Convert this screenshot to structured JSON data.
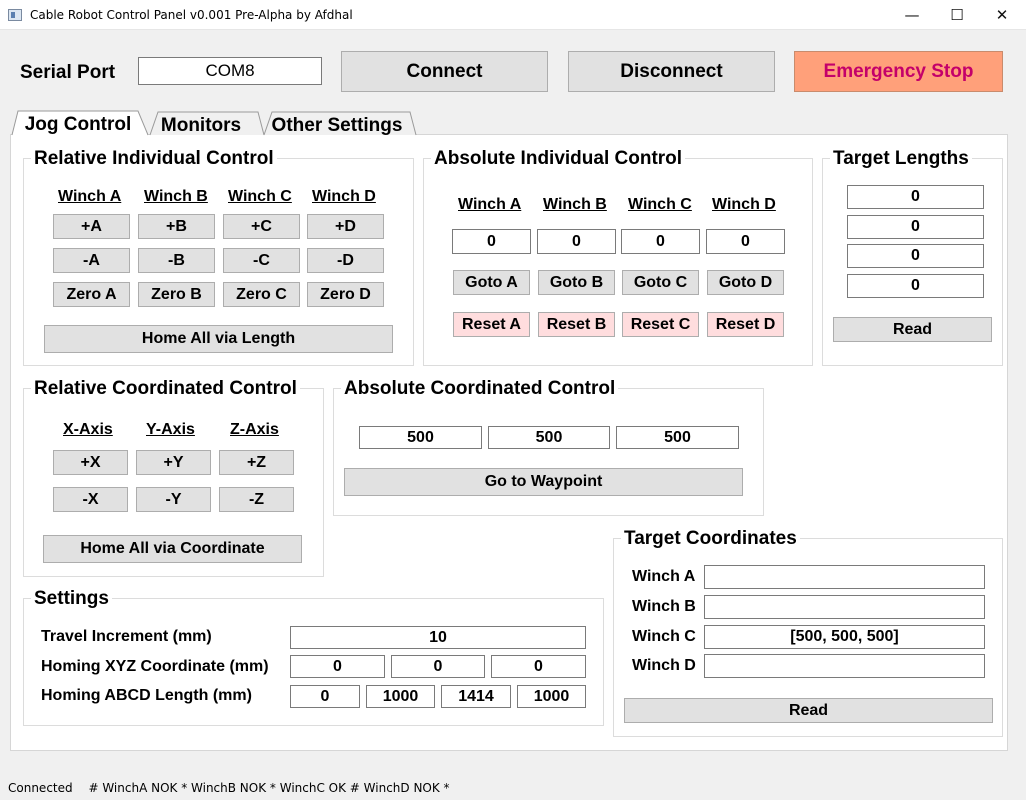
{
  "window": {
    "title": "Cable Robot Control Panel v0.001 Pre-Alpha by Afdhal",
    "controls": {
      "minimize": "—",
      "maximize": "☐",
      "close": "✕"
    }
  },
  "header": {
    "serial_port_label": "Serial Port",
    "serial_port_value": "COM8",
    "connect_label": "Connect",
    "disconnect_label": "Disconnect",
    "emergency_label": "Emergency Stop"
  },
  "tabs": [
    "Jog Control",
    "Monitors",
    "Other Settings"
  ],
  "relative_individual": {
    "title": "Relative Individual Control",
    "headers": [
      "Winch A",
      "Winch B",
      "Winch C",
      "Winch D"
    ],
    "plus": [
      "+A",
      "+B",
      "+C",
      "+D"
    ],
    "minus": [
      "-A",
      "-B",
      "-C",
      "-D"
    ],
    "zero": [
      "Zero A",
      "Zero B",
      "Zero C",
      "Zero D"
    ],
    "home_label": "Home All via Length"
  },
  "absolute_individual": {
    "title": "Absolute Individual Control",
    "headers": [
      "Winch A",
      "Winch B",
      "Winch C",
      "Winch D"
    ],
    "values": [
      "0",
      "0",
      "0",
      "0"
    ],
    "goto": [
      "Goto A",
      "Goto B",
      "Goto C",
      "Goto D"
    ],
    "reset": [
      "Reset A",
      "Reset B",
      "Reset C",
      "Reset D"
    ]
  },
  "target_lengths": {
    "title": "Target Lengths",
    "values": [
      "0",
      "0",
      "0",
      "0"
    ],
    "read_label": "Read"
  },
  "relative_coordinated": {
    "title": "Relative Coordinated Control",
    "headers": [
      "X-Axis",
      "Y-Axis",
      "Z-Axis"
    ],
    "plus": [
      "+X",
      "+Y",
      "+Z"
    ],
    "minus": [
      "-X",
      "-Y",
      "-Z"
    ],
    "home_label": "Home All via Coordinate"
  },
  "absolute_coordinated": {
    "title": "Absolute Coordinated Control",
    "values": [
      "500",
      "500",
      "500"
    ],
    "waypoint_label": "Go to Waypoint"
  },
  "target_coordinates": {
    "title": "Target Coordinates",
    "labels": [
      "Winch A",
      "Winch B",
      "Winch C",
      "Winch D"
    ],
    "values": [
      "",
      "",
      "[500, 500, 500]",
      ""
    ],
    "read_label": "Read"
  },
  "settings": {
    "title": "Settings",
    "travel_label": "Travel Increment (mm)",
    "travel_value": "10",
    "homing_xyz_label": "Homing XYZ Coordinate (mm)",
    "homing_xyz_values": [
      "0",
      "0",
      "0"
    ],
    "homing_abcd_label": "Homing ABCD Length (mm)",
    "homing_abcd_values": [
      "0",
      "1000",
      "1414",
      "1000"
    ]
  },
  "status_bar": {
    "connection": "Connected",
    "winch_status": "# WinchA NOK * WinchB NOK * WinchC OK  # WinchD NOK *"
  },
  "colors": {
    "emergency_bg": "#ffa07a",
    "emergency_text": "#c4006a",
    "reset_bg": "#ffddde"
  }
}
